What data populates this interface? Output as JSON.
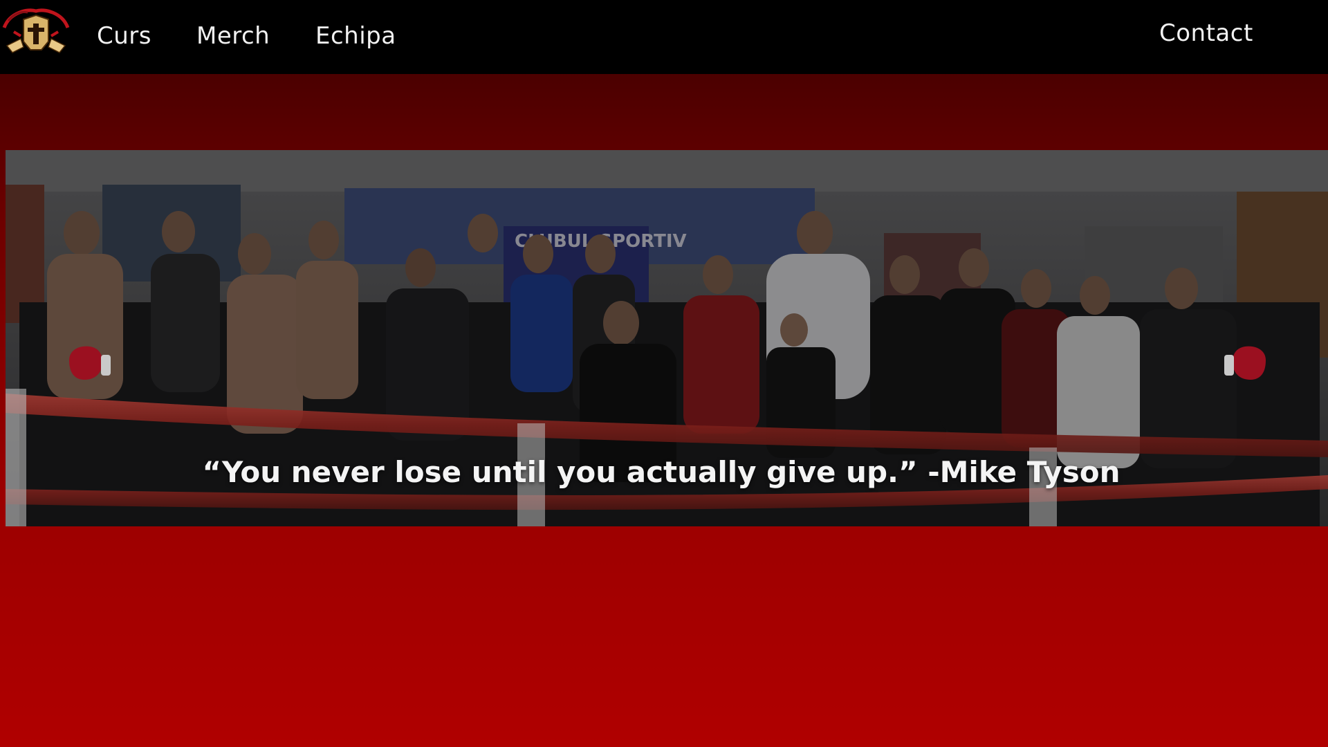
{
  "nav": {
    "links": [
      {
        "label": "Curs"
      },
      {
        "label": "Merch"
      },
      {
        "label": "Echipa"
      }
    ],
    "contact": "Contact"
  },
  "hero": {
    "banner_text": "CLUBUL SPORTIV",
    "quote": "“You never lose until you actually give up.” -Mike Tyson",
    "prev_icon": "boxing-glove-left-icon",
    "next_icon": "boxing-glove-right-icon"
  },
  "colors": {
    "nav_bg": "#000000",
    "accent": "#b00000",
    "glove": "#9b1020"
  }
}
